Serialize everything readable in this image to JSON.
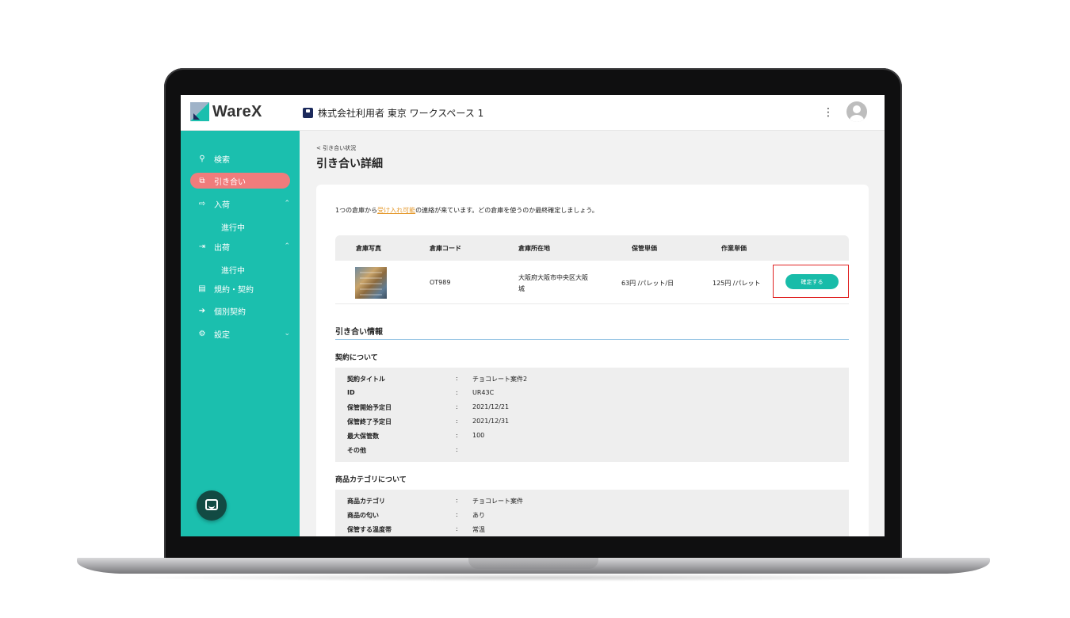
{
  "header": {
    "logo_text": "WareX",
    "workspace_title": "株式会社利用者 東京 ワークスペース 1",
    "menu_glyph": "⋮"
  },
  "sidebar": {
    "items": [
      {
        "label": "検索",
        "icon": "search-icon"
      },
      {
        "label": "引き合い",
        "icon": "inquiry-icon",
        "active": true
      },
      {
        "label": "入荷",
        "icon": "inbound-icon"
      },
      {
        "label": "進行中"
      },
      {
        "label": "出荷",
        "icon": "outbound-icon"
      },
      {
        "label": "進行中"
      },
      {
        "label": "規約・契約",
        "icon": "document-icon"
      },
      {
        "label": "個別契約",
        "icon": "sign-in-icon"
      },
      {
        "label": "設定",
        "icon": "gear-icon"
      }
    ]
  },
  "main": {
    "breadcrumb": "< 引き合い状況",
    "title": "引き合い詳細",
    "notice": {
      "before": "1つの倉庫から",
      "highlight": "受け入れ可能",
      "after": "の連絡が来ています。どの倉庫を使うのか最終確定しましょう。"
    },
    "table": {
      "headers": [
        "倉庫写真",
        "倉庫コード",
        "倉庫所在地",
        "保管単価",
        "作業単価"
      ],
      "row": {
        "code": "OT989",
        "address_line1": "大阪府大阪市中央区大阪",
        "address_line2": "城",
        "storage_price": "63円 /パレット/日",
        "work_price": "125円 /パレット",
        "confirm_label": "確定する"
      }
    },
    "inquiry_info_title": "引き合い情報",
    "contract": {
      "title": "契約について",
      "rows": [
        {
          "key": "契約タイトル",
          "value": "チョコレート案件2"
        },
        {
          "key": "ID",
          "value": "UR43C"
        },
        {
          "key": "保管開始予定日",
          "value": "2021/12/21"
        },
        {
          "key": "保管終了予定日",
          "value": "2021/12/31"
        },
        {
          "key": "最大保管数",
          "value": "100"
        },
        {
          "key": "その他",
          "value": ""
        }
      ]
    },
    "product": {
      "title": "商品カテゴリについて",
      "rows": [
        {
          "key": "商品カテゴリ",
          "value": "チョコレート案件"
        },
        {
          "key": "商品の匂い",
          "value": "あり"
        },
        {
          "key": "保管する温度帯",
          "value": "常温"
        }
      ]
    },
    "separator": ":"
  },
  "colors": {
    "sidebar": "#1bbfae",
    "active_nav": "#f07c7c",
    "highlight_text": "#e59a2e",
    "confirm_button": "#18bca9",
    "focus_box": "#e02424"
  }
}
